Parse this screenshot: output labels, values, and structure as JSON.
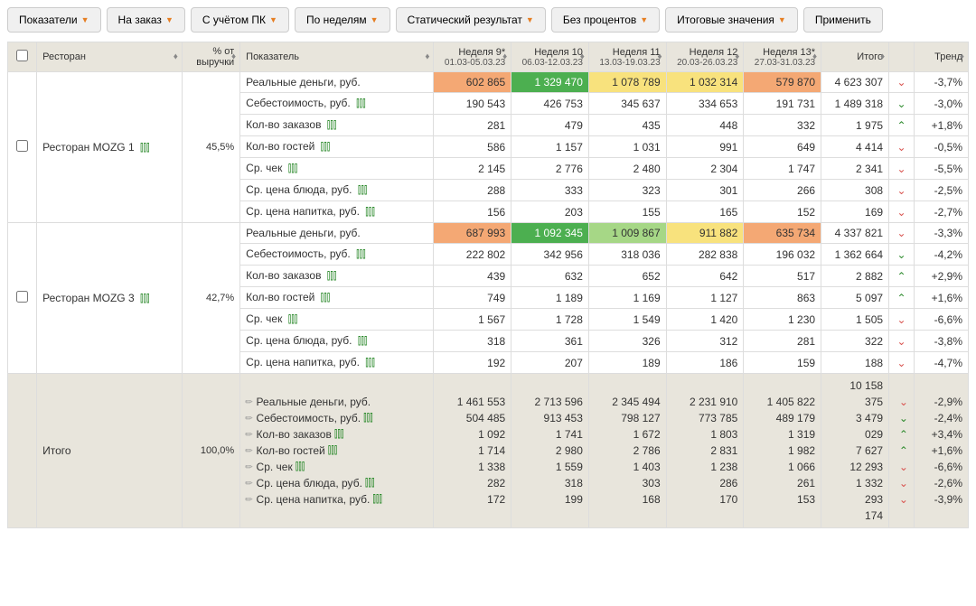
{
  "toolbar": {
    "b1": "Показатели",
    "b2": "На заказ",
    "b3": "С учётом ПК",
    "b4": "По неделям",
    "b5": "Статический результат",
    "b6": "Без процентов",
    "b7": "Итоговые значения",
    "apply": "Применить"
  },
  "headers": {
    "restaurant": "Ресторан",
    "pct": "% от выручки",
    "indicator": "Показатель",
    "w1": "Неделя 9*",
    "w1s": "01.03-05.03.23",
    "w2": "Неделя 10",
    "w2s": "06.03-12.03.23",
    "w3": "Неделя 11",
    "w3s": "13.03-19.03.23",
    "w4": "Неделя 12",
    "w4s": "20.03-26.03.23",
    "w5": "Неделя 13*",
    "w5s": "27.03-31.03.23",
    "total": "Итого",
    "trend": "Тренд"
  },
  "metrics": {
    "m1": "Реальные деньги, руб.",
    "m2": "Себестоимость, руб.",
    "m3": "Кол-во заказов",
    "m4": "Кол-во гостей",
    "m5": "Ср. чек",
    "m6": "Ср. цена блюда, руб.",
    "m7": "Ср. цена напитка, руб."
  },
  "r1": {
    "name": "Ресторан MOZG 1",
    "pct": "45,5%",
    "m1": {
      "w1": "602 865",
      "w2": "1 329 470",
      "w3": "1 078 789",
      "w4": "1 032 314",
      "w5": "579 870",
      "tot": "4 623 307",
      "tr": "-3,7%",
      "dir": "down"
    },
    "m2": {
      "w1": "190 543",
      "w2": "426 753",
      "w3": "345 637",
      "w4": "334 653",
      "w5": "191 731",
      "tot": "1 489 318",
      "tr": "-3,0%",
      "dir": "down-g"
    },
    "m3": {
      "w1": "281",
      "w2": "479",
      "w3": "435",
      "w4": "448",
      "w5": "332",
      "tot": "1 975",
      "tr": "+1,8%",
      "dir": "up"
    },
    "m4": {
      "w1": "586",
      "w2": "1 157",
      "w3": "1 031",
      "w4": "991",
      "w5": "649",
      "tot": "4 414",
      "tr": "-0,5%",
      "dir": "down"
    },
    "m5": {
      "w1": "2 145",
      "w2": "2 776",
      "w3": "2 480",
      "w4": "2 304",
      "w5": "1 747",
      "tot": "2 341",
      "tr": "-5,5%",
      "dir": "down"
    },
    "m6": {
      "w1": "288",
      "w2": "333",
      "w3": "323",
      "w4": "301",
      "w5": "266",
      "tot": "308",
      "tr": "-2,5%",
      "dir": "down"
    },
    "m7": {
      "w1": "156",
      "w2": "203",
      "w3": "155",
      "w4": "165",
      "w5": "152",
      "tot": "169",
      "tr": "-2,7%",
      "dir": "down"
    }
  },
  "r2": {
    "name": "Ресторан MOZG 3",
    "pct": "42,7%",
    "m1": {
      "w1": "687 993",
      "w2": "1 092 345",
      "w3": "1 009 867",
      "w4": "911 882",
      "w5": "635 734",
      "tot": "4 337 821",
      "tr": "-3,3%",
      "dir": "down"
    },
    "m2": {
      "w1": "222 802",
      "w2": "342 956",
      "w3": "318 036",
      "w4": "282 838",
      "w5": "196 032",
      "tot": "1 362 664",
      "tr": "-4,2%",
      "dir": "down-g"
    },
    "m3": {
      "w1": "439",
      "w2": "632",
      "w3": "652",
      "w4": "642",
      "w5": "517",
      "tot": "2 882",
      "tr": "+2,9%",
      "dir": "up"
    },
    "m4": {
      "w1": "749",
      "w2": "1 189",
      "w3": "1 169",
      "w4": "1 127",
      "w5": "863",
      "tot": "5 097",
      "tr": "+1,6%",
      "dir": "up"
    },
    "m5": {
      "w1": "1 567",
      "w2": "1 728",
      "w3": "1 549",
      "w4": "1 420",
      "w5": "1 230",
      "tot": "1 505",
      "tr": "-6,6%",
      "dir": "down"
    },
    "m6": {
      "w1": "318",
      "w2": "361",
      "w3": "326",
      "w4": "312",
      "w5": "281",
      "tot": "322",
      "tr": "-3,8%",
      "dir": "down"
    },
    "m7": {
      "w1": "192",
      "w2": "207",
      "w3": "189",
      "w4": "186",
      "w5": "159",
      "tot": "188",
      "tr": "-4,7%",
      "dir": "down"
    }
  },
  "totals": {
    "name": "Итого",
    "pct": "100,0%",
    "tot_pre": "10 158",
    "tot_post": "174",
    "m1": {
      "w1": "1 461 553",
      "w2": "2 713 596",
      "w3": "2 345 494",
      "w4": "2 231 910",
      "w5": "1 405 822",
      "tot": "375",
      "tr": "-2,9%",
      "dir": "down"
    },
    "m2": {
      "w1": "504 485",
      "w2": "913 453",
      "w3": "798 127",
      "w4": "773 785",
      "w5": "489 179",
      "tot": "3 479",
      "tr": "-2,4%",
      "dir": "down-g"
    },
    "m3": {
      "w1": "1 092",
      "w2": "1 741",
      "w3": "1 672",
      "w4": "1 803",
      "w5": "1 319",
      "tot": "029",
      "tr": "+3,4%",
      "dir": "up"
    },
    "m4": {
      "w1": "1 714",
      "w2": "2 980",
      "w3": "2 786",
      "w4": "2 831",
      "w5": "1 982",
      "tot": "7 627",
      "tr": "+1,6%",
      "dir": "up"
    },
    "m5": {
      "w1": "1 338",
      "w2": "1 559",
      "w3": "1 403",
      "w4": "1 238",
      "w5": "1 066",
      "tot": "12 293",
      "tr": "-6,6%",
      "dir": "down"
    },
    "m6": {
      "w1": "282",
      "w2": "318",
      "w3": "303",
      "w4": "286",
      "w5": "261",
      "tot": "1 332",
      "tr": "-2,6%",
      "dir": "down"
    },
    "m7": {
      "w1": "172",
      "w2": "199",
      "w3": "168",
      "w4": "170",
      "w5": "153",
      "tot": "293",
      "tr": "-3,9%",
      "dir": "down"
    }
  },
  "chart_data": {
    "type": "table",
    "title": "Weekly restaurant metrics",
    "weeks": [
      "Неделя 9* 01.03-05.03.23",
      "Неделя 10 06.03-12.03.23",
      "Неделя 11 13.03-19.03.23",
      "Неделя 12 20.03-26.03.23",
      "Неделя 13* 27.03-31.03.23"
    ],
    "restaurants": [
      {
        "name": "Ресторан MOZG 1",
        "revenue_pct": 45.5,
        "metrics": {
          "Реальные деньги, руб.": [
            602865,
            1329470,
            1078789,
            1032314,
            579870
          ],
          "Себестоимость, руб.": [
            190543,
            426753,
            345637,
            334653,
            191731
          ],
          "Кол-во заказов": [
            281,
            479,
            435,
            448,
            332
          ],
          "Кол-во гостей": [
            586,
            1157,
            1031,
            991,
            649
          ],
          "Ср. чек": [
            2145,
            2776,
            2480,
            2304,
            1747
          ],
          "Ср. цена блюда, руб.": [
            288,
            333,
            323,
            301,
            266
          ],
          "Ср. цена напитка, руб.": [
            156,
            203,
            155,
            165,
            152
          ]
        }
      },
      {
        "name": "Ресторан MOZG 3",
        "revenue_pct": 42.7,
        "metrics": {
          "Реальные деньги, руб.": [
            687993,
            1092345,
            1009867,
            911882,
            635734
          ],
          "Себестоимость, руб.": [
            222802,
            342956,
            318036,
            282838,
            196032
          ],
          "Кол-во заказов": [
            439,
            632,
            652,
            642,
            517
          ],
          "Кол-во гостей": [
            749,
            1189,
            1169,
            1127,
            863
          ],
          "Ср. чек": [
            1567,
            1728,
            1549,
            1420,
            1230
          ],
          "Ср. цена блюда, руб.": [
            318,
            361,
            326,
            312,
            281
          ],
          "Ср. цена напитка, руб.": [
            192,
            207,
            189,
            186,
            159
          ]
        }
      }
    ]
  }
}
